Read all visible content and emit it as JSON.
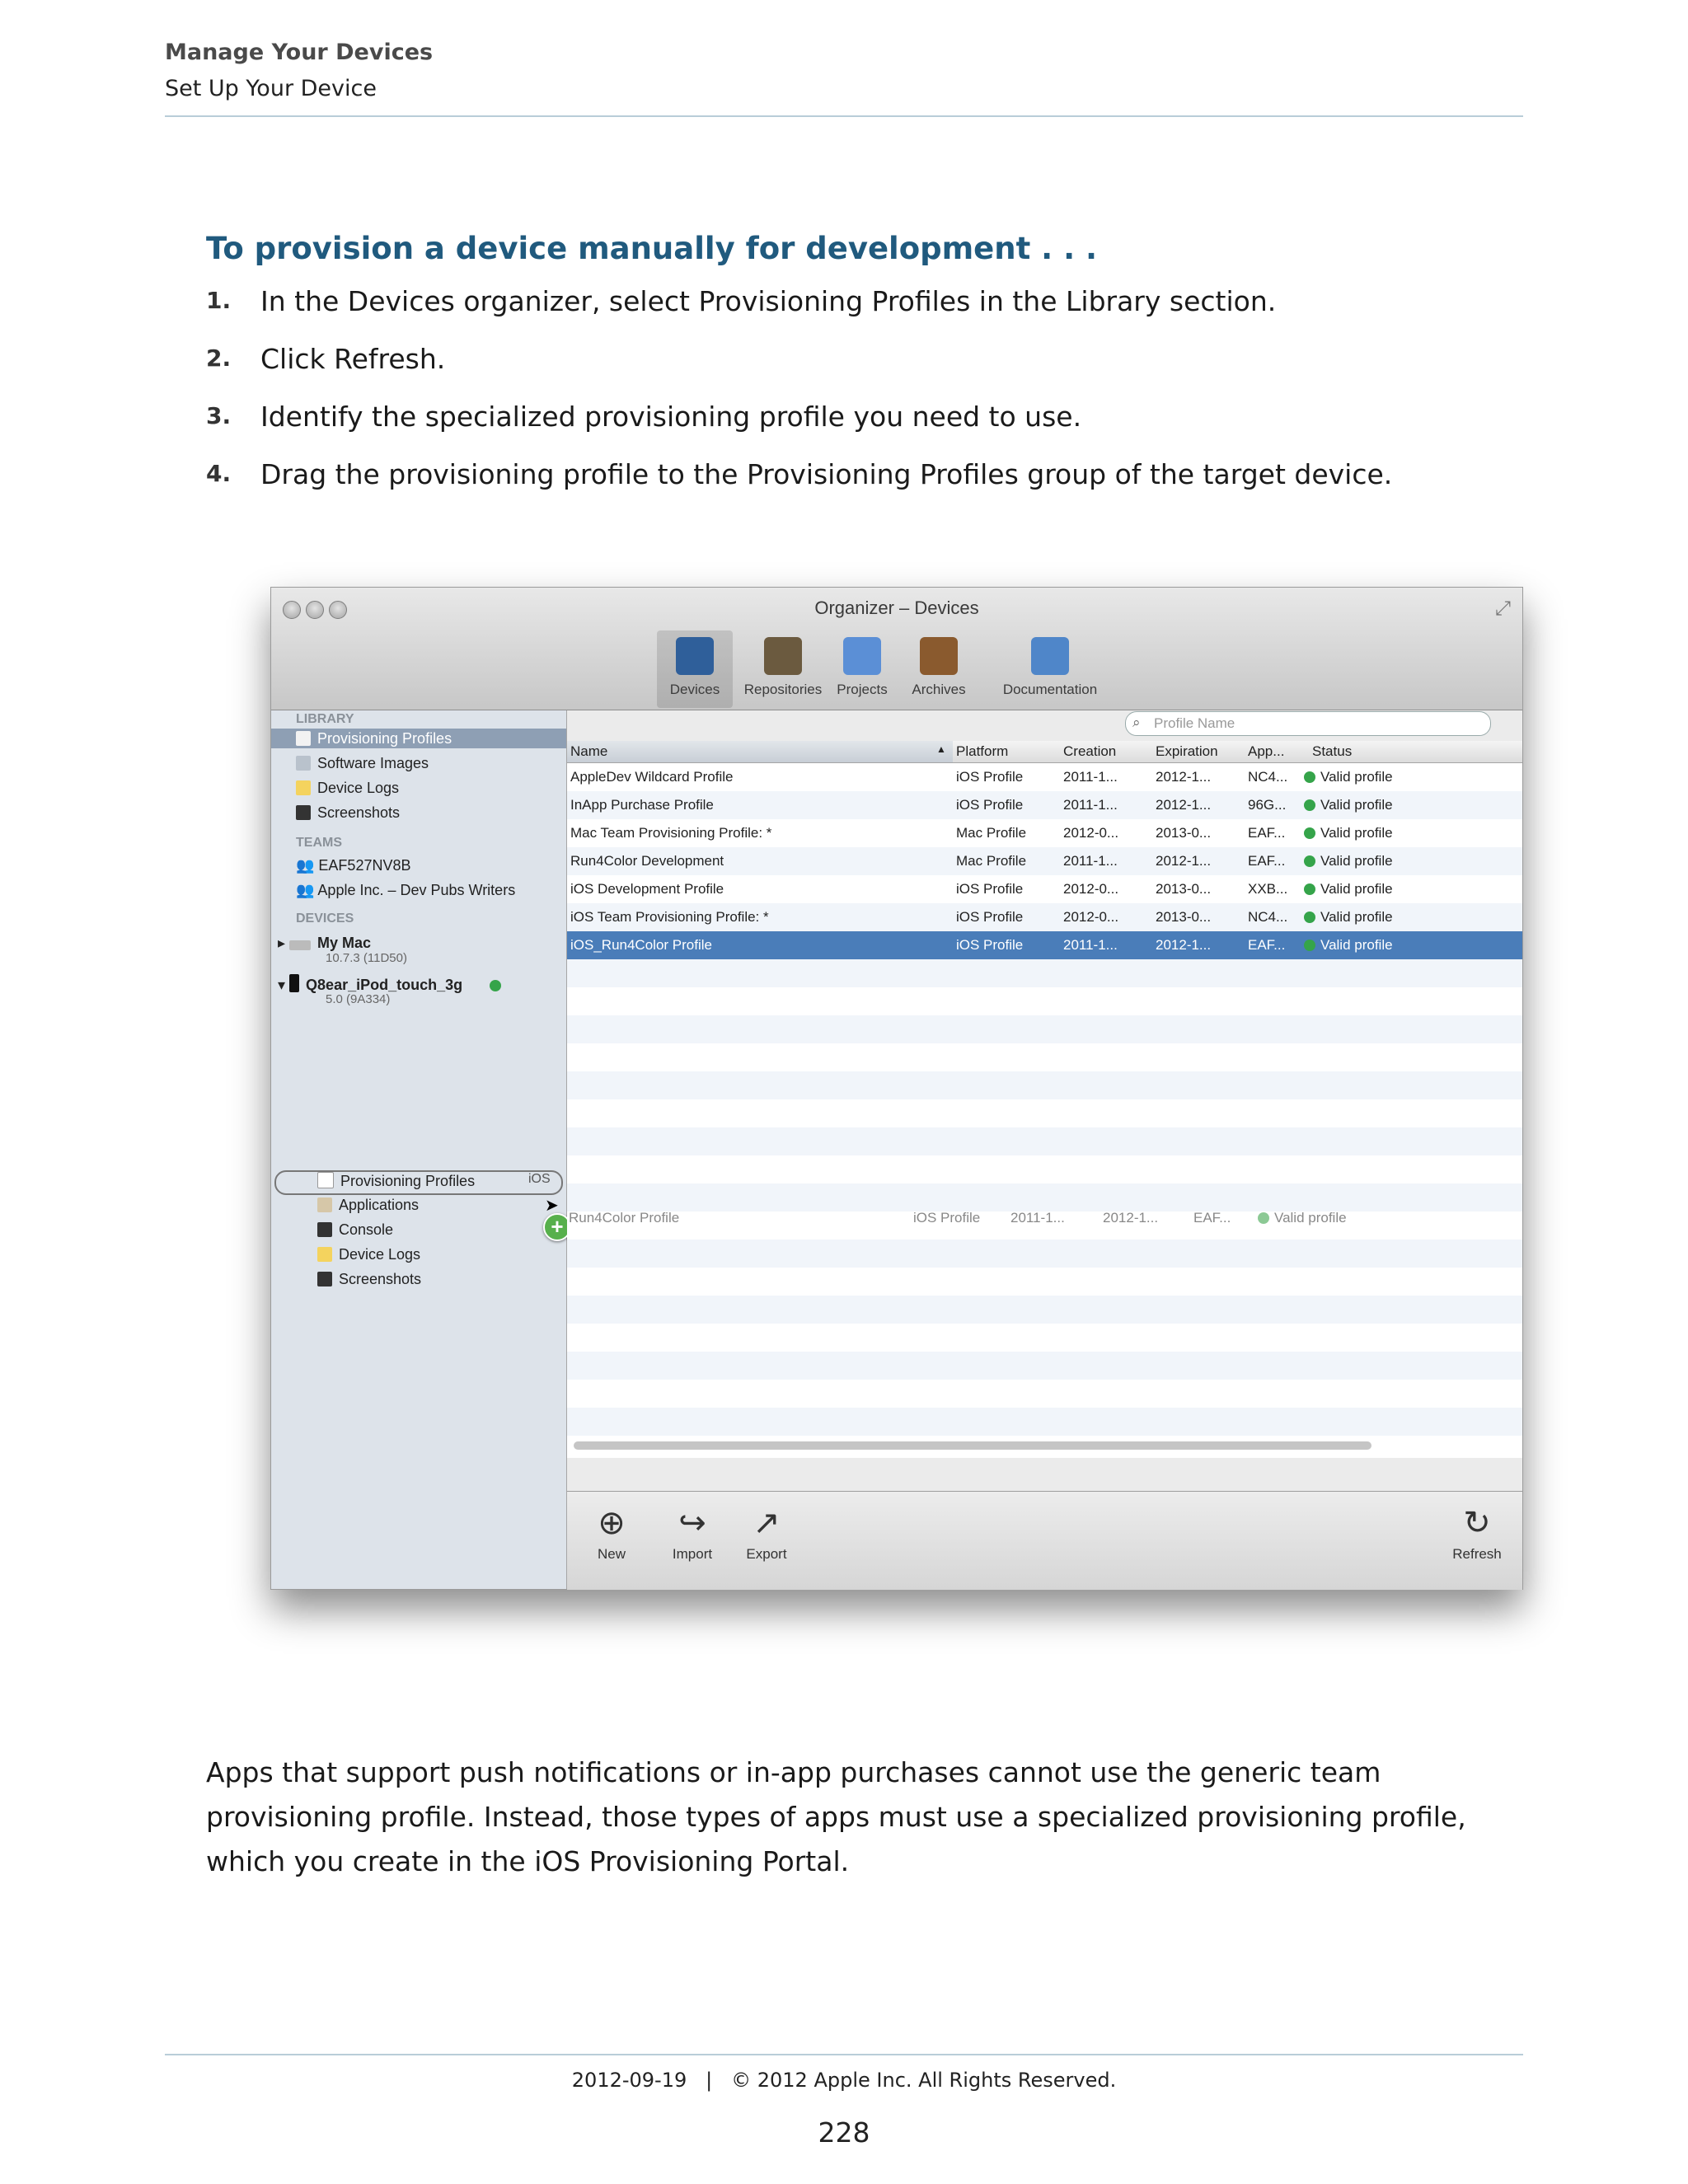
{
  "header": {
    "chapter": "Manage Your Devices",
    "section": "Set Up Your Device"
  },
  "task": {
    "heading": "To provision a device manually for development . . .",
    "steps": [
      {
        "num": "1.",
        "text": "In the Devices organizer, select Provisioning Profiles in the Library section."
      },
      {
        "num": "2.",
        "text": "Click Refresh."
      },
      {
        "num": "3.",
        "text": "Identify the specialized provisioning profile you need to use."
      },
      {
        "num": "4.",
        "text": "Drag the provisioning profile to the Provisioning Profiles group of the target device."
      }
    ]
  },
  "window": {
    "title": "Organizer – Devices",
    "toolbar": [
      {
        "label": "Devices",
        "icon": "devices-icon",
        "color": "#2f5f9a"
      },
      {
        "label": "Repositories",
        "icon": "repositories-icon",
        "color": "#6b5a3f"
      },
      {
        "label": "Projects",
        "icon": "projects-icon",
        "color": "#5b8fd6"
      },
      {
        "label": "Archives",
        "icon": "archives-icon",
        "color": "#8a5a2e"
      },
      {
        "label": "Documentation",
        "icon": "documentation-icon",
        "color": "#4f86c9"
      }
    ],
    "sidebar": {
      "library_label": "LIBRARY",
      "library": [
        "Provisioning Profiles",
        "Software Images",
        "Device Logs",
        "Screenshots"
      ],
      "teams_label": "TEAMS",
      "teams": [
        "EAF527NV8B",
        "Apple Inc. – Dev Pubs Writers"
      ],
      "devices_label": "DEVICES",
      "devices": [
        {
          "name": "My Mac",
          "sub": "10.7.3 (11D50)"
        },
        {
          "name": "Q8ear_iPod_touch_3g",
          "sub": "5.0 (9A334)"
        }
      ],
      "device_children": [
        "Provisioning Profiles",
        "Applications",
        "Console",
        "Device Logs",
        "Screenshots"
      ],
      "drag_tag": "iOS"
    },
    "search_placeholder": "Profile Name",
    "columns": [
      "Name",
      "Platform",
      "Creation",
      "Expiration",
      "App...",
      "Status"
    ],
    "rows": [
      {
        "name": "AppleDev Wildcard Profile",
        "platform": "iOS Profile",
        "creation": "2011-1...",
        "expiration": "2012-1...",
        "app": "NC4...",
        "status": "Valid profile"
      },
      {
        "name": "InApp Purchase Profile",
        "platform": "iOS Profile",
        "creation": "2011-1...",
        "expiration": "2012-1...",
        "app": "96G...",
        "status": "Valid profile"
      },
      {
        "name": "Mac Team Provisioning Profile: *",
        "platform": "Mac Profile",
        "creation": "2012-0...",
        "expiration": "2013-0...",
        "app": "EAF...",
        "status": "Valid profile"
      },
      {
        "name": "Run4Color Development",
        "platform": "Mac Profile",
        "creation": "2011-1...",
        "expiration": "2012-1...",
        "app": "EAF...",
        "status": "Valid profile"
      },
      {
        "name": "iOS Development Profile",
        "platform": "iOS Profile",
        "creation": "2012-0...",
        "expiration": "2013-0...",
        "app": "XXB...",
        "status": "Valid profile"
      },
      {
        "name": "iOS Team Provisioning Profile: *",
        "platform": "iOS Profile",
        "creation": "2012-0...",
        "expiration": "2013-0...",
        "app": "NC4...",
        "status": "Valid profile"
      },
      {
        "name": "iOS_Run4Color Profile",
        "platform": "iOS Profile",
        "creation": "2011-1...",
        "expiration": "2012-1...",
        "app": "EAF...",
        "status": "Valid profile"
      }
    ],
    "drag_ghost": {
      "name": "Run4Color Profile",
      "platform": "iOS Profile",
      "creation": "2011-1...",
      "expiration": "2012-1...",
      "app": "EAF...",
      "status": "Valid profile"
    },
    "bottom": {
      "new": "New",
      "import": "Import",
      "export": "Export",
      "refresh": "Refresh"
    }
  },
  "body_text": "Apps that support push notifications or in-app purchases cannot use the generic team provisioning profile. Instead, those types of apps must use a specialized provisioning profile, which you create in the iOS Provisioning Portal.",
  "footer": {
    "text": "2012-09-19   |   © 2012 Apple Inc. All Rights Reserved.",
    "page": "228"
  }
}
